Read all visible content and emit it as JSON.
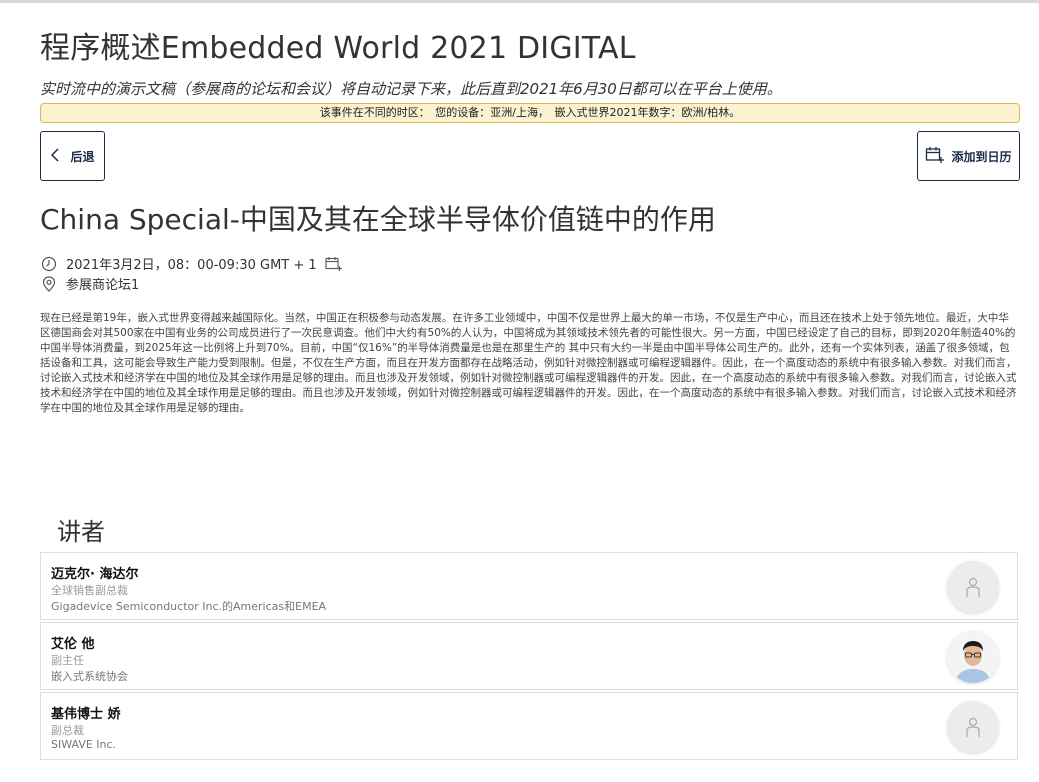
{
  "header": {
    "title": "程序概述Embedded World 2021 DIGITAL",
    "subtitle": "实时流中的演示文稿（参展商的论坛和会议）将自动记录下来，此后直到2021年6月30日都可以在平台上使用。",
    "timezone_notice": "该事件在不同的时区：　您的设备：亚洲/上海，　嵌入式世界2021年数字：欧洲/柏林。"
  },
  "actions": {
    "back_label": "后退",
    "add_calendar_label": "添加到日历"
  },
  "session": {
    "title": "China Special-中国及其在全球半导体价值链中的作用",
    "datetime": "2021年3月2日，08：00-09:30 GMT + 1",
    "location": "参展商论坛1",
    "description": "现在已经是第19年，嵌入式世界变得越来越国际化。当然，中国正在积极参与动态发展。在许多工业领域中，中国不仅是世界上最大的单一市场，不仅是生产中心，而且还在技术上处于领先地位。最近，大中华区德国商会对其500家在中国有业务的公司成员进行了一次民意调查。他们中大约有50%的人认为，中国将成为其领域技术领先者的可能性很大。另一方面，中国已经设定了自己的目标，即到2020年制造40%的中国半导体消费量，到2025年这一比例将上升到70%。目前，中国“仅16%”的半导体消费量是也是在那里生产的 其中只有大约一半是由中国半导体公司生产的。此外，还有一个实体列表，涵盖了很多领域，包括设备和工具，这可能会导致生产能力受到限制。但是，不仅在生产方面，而且在开发方面都存在战略活动，例如针对微控制器或可编程逻辑器件。因此，在一个高度动态的系统中有很多输入参数。对我们而言，讨论嵌入式技术和经济学在中国的地位及其全球作用是足够的理由。而且也涉及开发领域，例如针对微控制器或可编程逻辑器件的开发。因此，在一个高度动态的系统中有很多输入参数。对我们而言，讨论嵌入式技术和经济学在中国的地位及其全球作用是足够的理由。而且也涉及开发领域，例如针对微控制器或可编程逻辑器件的开发。因此，在一个高度动态的系统中有很多输入参数。对我们而言，讨论嵌入式技术和经济学在中国的地位及其全球作用是足够的理由。"
  },
  "speakers": {
    "heading": "讲者",
    "items": [
      {
        "name": "迈克尔· 海达尔",
        "role": "全球销售副总裁",
        "org": "Gigadevice Semiconductor Inc.的Americas和EMEA",
        "avatar": "placeholder-person-icon"
      },
      {
        "name": "艾伦 他",
        "role": "副主任",
        "org": "嵌入式系统协会",
        "avatar": "person-photo"
      },
      {
        "name": "基伟博士 娇",
        "role": "副总裁",
        "org": "SIWAVE Inc.",
        "avatar": "placeholder-person-icon"
      }
    ]
  },
  "colors": {
    "accent": "#1c2a4a",
    "notice_bg": "#fbf3cf",
    "notice_border": "#d9bb54"
  },
  "icons": {
    "back": "chevron-left-icon",
    "calendar_add": "calendar-plus-icon",
    "clock": "clock-icon",
    "location": "location-pin-icon"
  }
}
